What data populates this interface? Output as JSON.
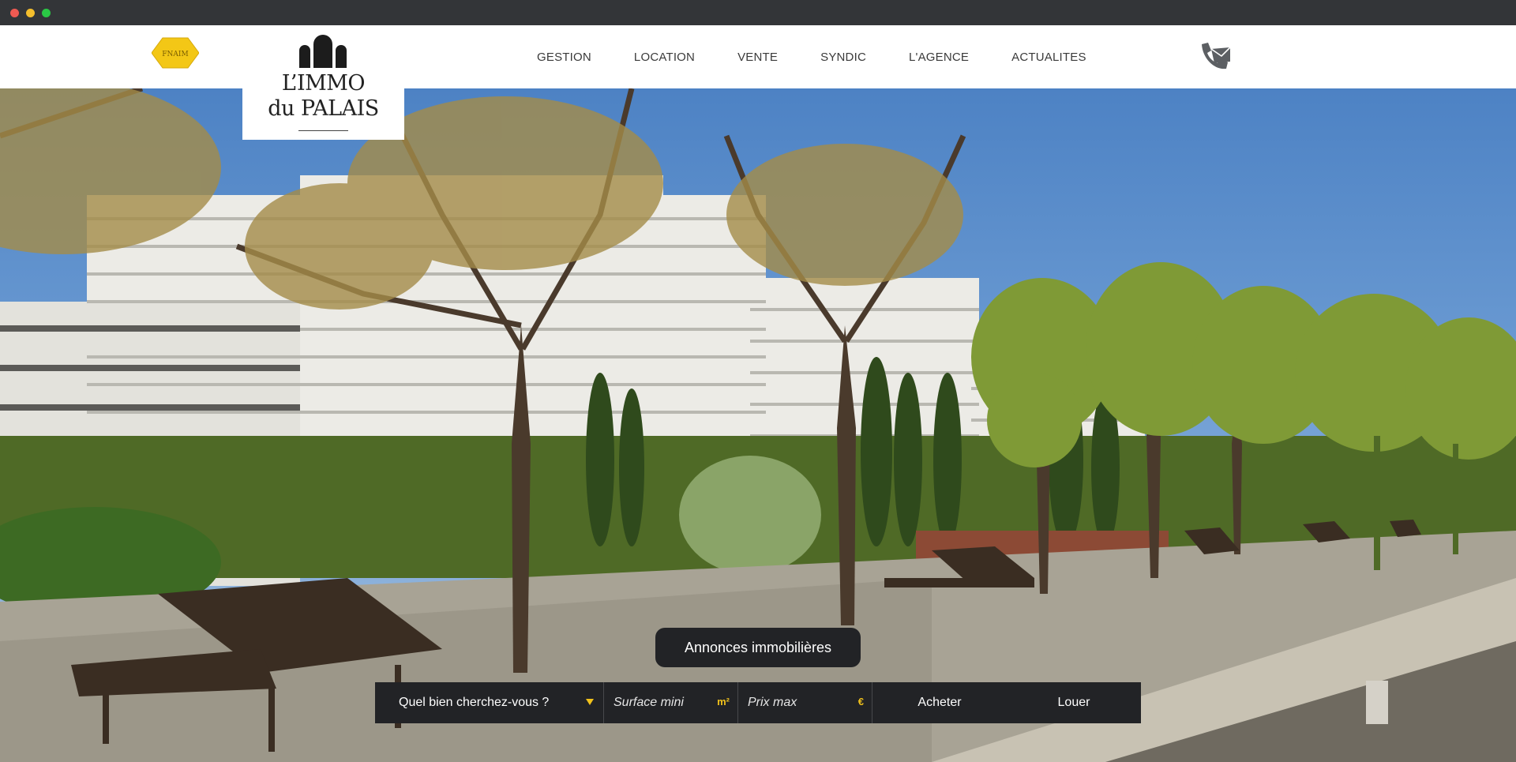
{
  "brand": {
    "fnaim_badge": "FNAIM",
    "logo_line1": "L’IMMO",
    "logo_line2": "du PALAIS"
  },
  "nav": {
    "items": [
      {
        "label": "GESTION"
      },
      {
        "label": "LOCATION"
      },
      {
        "label": "VENTE"
      },
      {
        "label": "SYNDIC"
      },
      {
        "label": "L'AGENCE"
      },
      {
        "label": "ACTUALITES"
      }
    ]
  },
  "search": {
    "tab_label": "Annonces immobilières",
    "type_label": "Quel bien cherchez-vous ?",
    "surface_placeholder": "Surface mini",
    "surface_unit": "m²",
    "price_placeholder": "Prix max",
    "price_unit": "€",
    "buy_label": "Acheter",
    "rent_label": "Louer"
  },
  "icons": {
    "contact": "phone-mail-icon",
    "caret": "chevron-down-icon"
  },
  "colors": {
    "accent": "#f2c21b",
    "search_bg": "#222326",
    "chrome_bg": "#333538"
  }
}
